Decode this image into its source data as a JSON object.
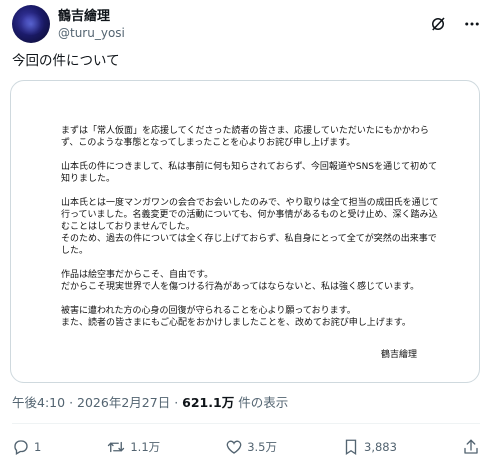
{
  "author": {
    "display_name": "鶴吉繪理",
    "handle": "@turu_yosi"
  },
  "tweet": {
    "text": "今回の件について"
  },
  "statement": {
    "paragraphs": [
      "まずは「常人仮面」を応援してくださった読者の皆さま、応援していただいたにもかかわらず、このような事態となってしまったことを心よりお詫び申し上げます。",
      "山本氏の件につきまして、私は事前に何も知らされておらず、今回報道やSNSを通じて初めて知りました。",
      "山本氏とは一度マンガワンの会合でお会いしたのみで、やり取りは全て担当の成田氏を通じて行っていました。名義変更での活動についても、何か事情があるものと受け止め、深く踏み込むことはしておりませんでした。\nそのため、過去の件については全く存じ上げておらず、私自身にとって全てが突然の出来事でした。",
      "作品は絵空事だからこそ、自由です。\nだからこそ現実世界で人を傷つける行為があってはならないと、私は強く感じています。",
      "被害に遭われた方の心身の回復が守られることを心より願っております。\nまた、読者の皆さまにもご心配をおかけしましたことを、改めてお詫び申し上げます。"
    ],
    "signature": "鶴吉繪理"
  },
  "meta": {
    "time": "午後4:10",
    "separator": "·",
    "date": "2026年2月27日",
    "views_count": "621.1万",
    "views_label": "件の表示"
  },
  "actions": {
    "replies": "1",
    "reposts": "1.1万",
    "likes": "3.5万",
    "bookmarks": "3,883"
  },
  "icons": {
    "grok": "grok-icon",
    "more": "more-icon",
    "reply": "reply-icon",
    "repost": "repost-icon",
    "like": "like-icon",
    "bookmark": "bookmark-icon",
    "share": "share-icon"
  }
}
